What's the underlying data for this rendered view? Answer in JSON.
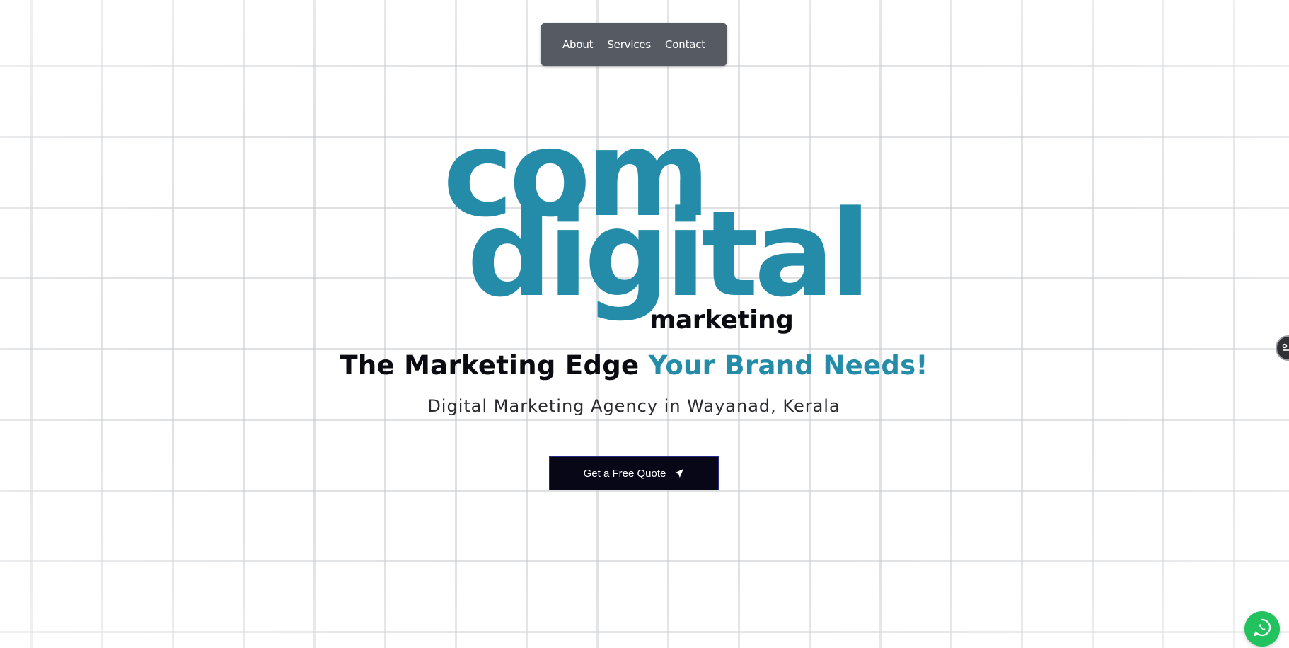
{
  "nav": {
    "items": [
      {
        "label": "About"
      },
      {
        "label": "Services"
      },
      {
        "label": "Contact"
      }
    ]
  },
  "logo": {
    "line1": "com",
    "line2": "digital",
    "line3": "marketing"
  },
  "hero": {
    "headline_part1": "The Marketing Edge",
    "headline_part2": "Your Brand Needs!",
    "subheadline": "Digital Marketing Agency in Wayanad, Kerala",
    "cta_label": "Get a Free Quote",
    "cta_icon": "send-arrow-icon"
  },
  "widgets": {
    "side_toggle_icon": "accessibility-toggle-icon",
    "whatsapp_icon": "whatsapp-icon"
  },
  "colors": {
    "brand_teal": "#248ca9",
    "dark": "#070718",
    "nav_bg": "#565a63",
    "whatsapp_green": "#22c35e"
  }
}
